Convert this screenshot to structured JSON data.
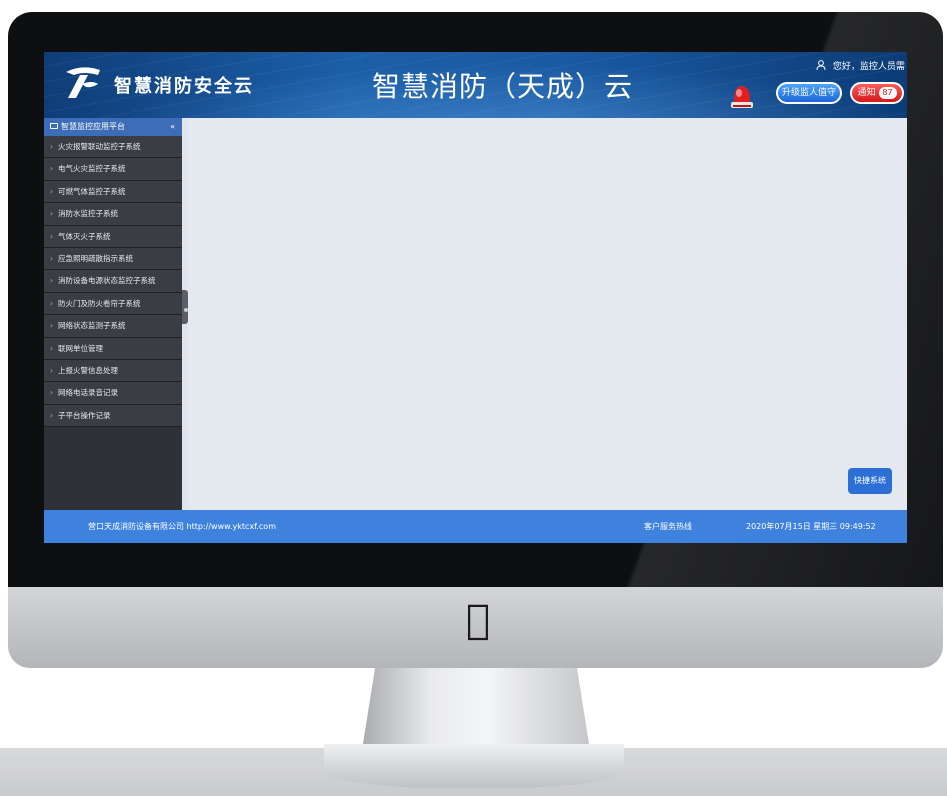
{
  "header": {
    "brand_name": "智慧消防安全云",
    "center_title": "智慧消防（天成）云",
    "user_greeting": "您好，监控人员需",
    "login_button": "升级监人值守",
    "notice_button": "通知",
    "notice_count": "87"
  },
  "sidebar": {
    "title": "智慧监控应用平台",
    "toggle": "«",
    "items": [
      "火灾报警联动监控子系统",
      "电气火灾监控子系统",
      "可燃气体监控子系统",
      "消防水监控子系统",
      "气体灭火子系统",
      "应急照明疏散指示系统",
      "消防设备电源状态监控子系统",
      "防火门及防火卷帘子系统",
      "网络状态监测子系统",
      "联网单位管理",
      "上报火警信息处理",
      "网络电话录音记录",
      "子平台操作记录"
    ]
  },
  "main": {
    "quick_button": "快捷系统"
  },
  "footer": {
    "company": "营口天成消防设备有限公司 http://www.yktcxf.com",
    "service": "客户服务热线",
    "datetime": "2020年07月15日 星期三 09:49:52"
  },
  "colors": {
    "header_blue": "#1b5fa8",
    "sidebar_dark": "#2e3138",
    "sidebar_head": "#3d6db6",
    "footer_blue": "#3e82dd",
    "notice_red": "#d21818",
    "main_bg": "#e4e8ef"
  },
  "icons": {
    "logo": "tc-logo-icon",
    "alarm": "alarm-light-icon",
    "user": "user-icon",
    "apple": "apple-icon"
  }
}
